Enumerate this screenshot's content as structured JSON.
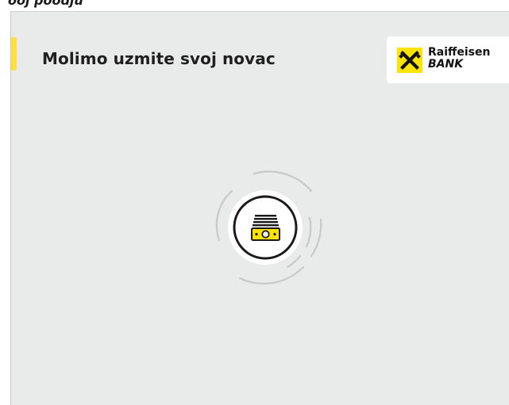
{
  "top_strip": {
    "text": "ooj poodju"
  },
  "screen": {
    "title": "Molimo uzmite svoj novac"
  },
  "logo": {
    "name": "Raiffeisen",
    "sub": "BANK"
  },
  "icons": {
    "logo_mark": "raiffeisen-gable-cross-icon",
    "cash": "cash-stack-icon",
    "spinner": "loading-arcs-icon"
  },
  "colors": {
    "accent": "#fde03c",
    "background": "#e9eaea",
    "text": "#1f1f1f",
    "logo_yellow": "#fce300",
    "arc_gray": "#c9c9c9"
  }
}
